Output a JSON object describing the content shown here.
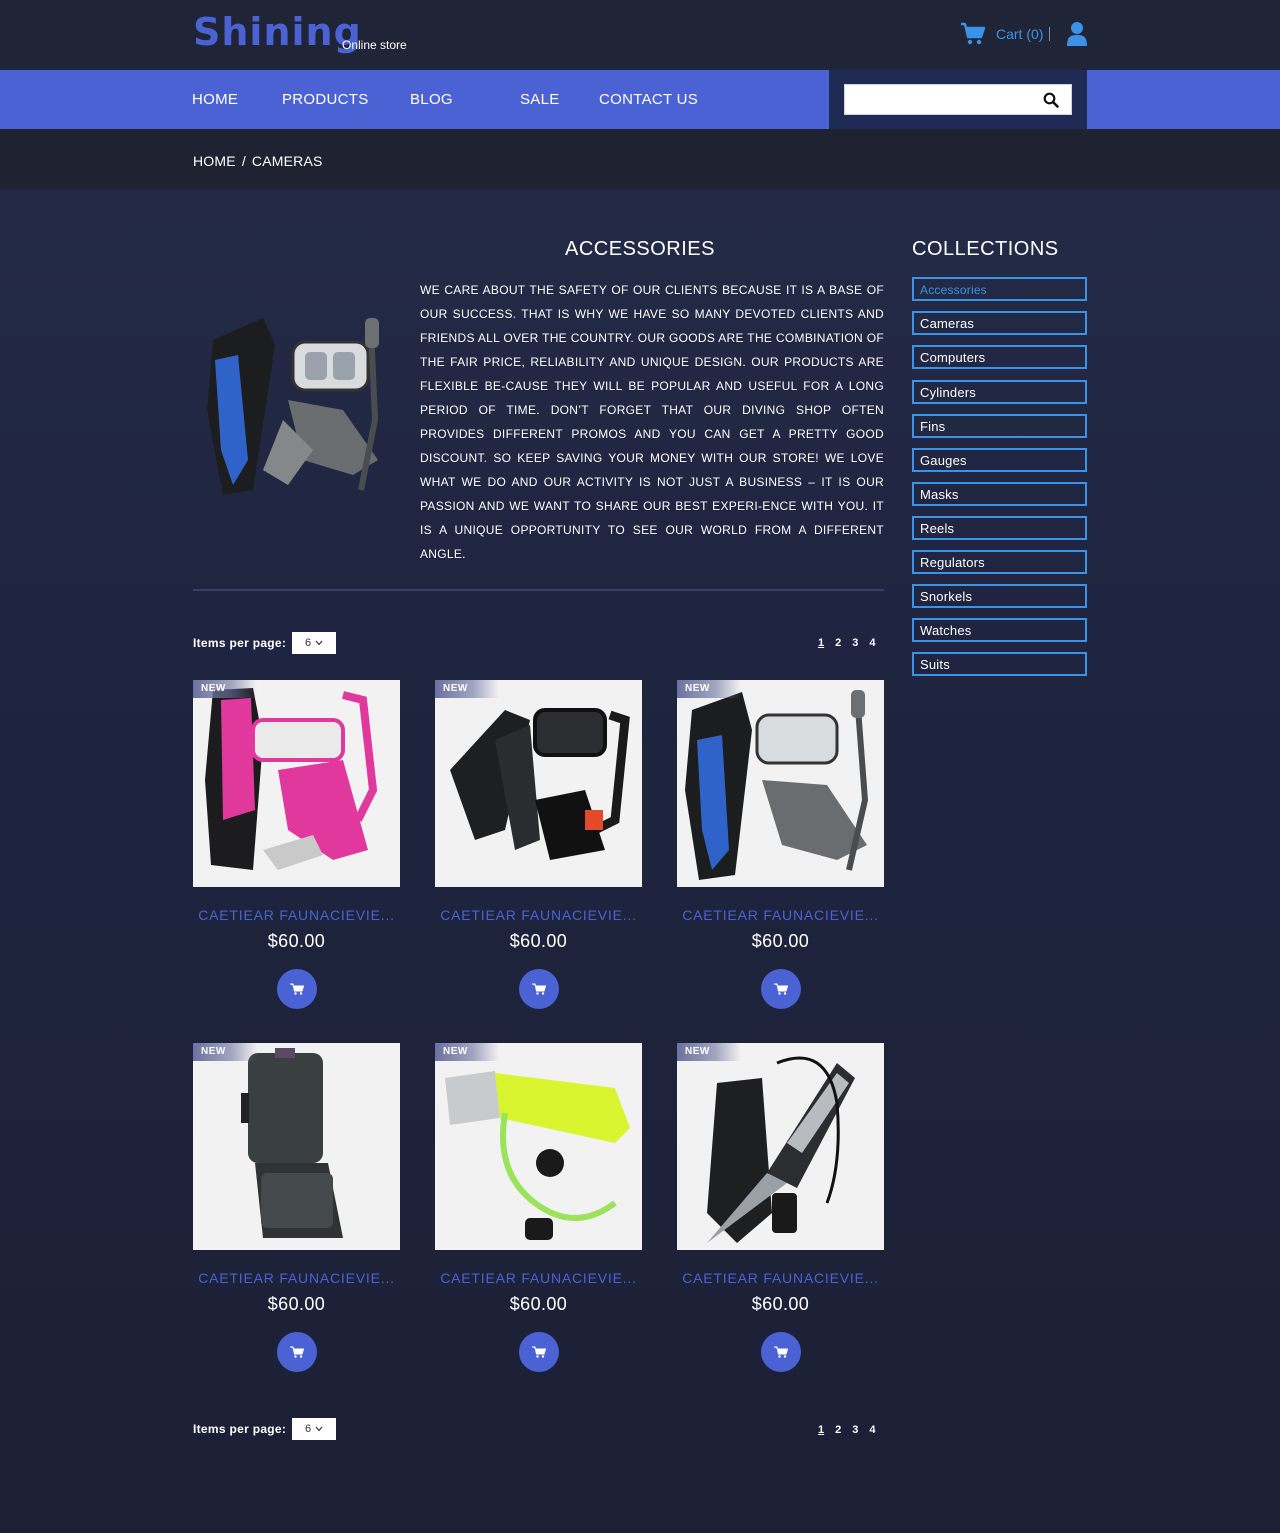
{
  "header": {
    "logo": "Shining",
    "tagline": "Online store",
    "cart_label": "Cart (0)"
  },
  "nav": {
    "items": [
      "HOME",
      "PRODUCTS",
      "BLOG",
      "SALE",
      "CONTACT US"
    ],
    "search_placeholder": ""
  },
  "breadcrumb": {
    "home": "HOME",
    "separator": "/",
    "current": "CAMERAS"
  },
  "category": {
    "title": "ACCESSORIES",
    "description": "We care about the safety of our clients because it is a base of our success. That is why we have so many devoted clients and friends all over the country. Our goods are the combination of the fair price, reliability and unique design. Our products are flexible be-cause they will be popular and useful for a long period of time. Don’t forget that our diving shop often provides different promos and you can get a pretty good discount. So keep saving your money with our store! We love what we do and our activity is not just a business – it is our passion and we want to share our best experi-ence with you. It is a unique opportunity to see our world from a different angle."
  },
  "listing": {
    "items_per_page_label": "Items per page:",
    "items_per_page_value": "6",
    "pages": [
      "1",
      "2",
      "3",
      "4"
    ],
    "current_page": "1"
  },
  "products": [
    {
      "badge": "NEW",
      "name": "CAETIEAR FAUNACIEVIE...",
      "price": "$60.00",
      "image": "pink-snorkel-set"
    },
    {
      "badge": "NEW",
      "name": "CAETIEAR FAUNACIEVIE...",
      "price": "$60.00",
      "image": "black-fins-mask-set"
    },
    {
      "badge": "NEW",
      "name": "CAETIEAR FAUNACIEVIE...",
      "price": "$60.00",
      "image": "blue-snorkel-set"
    },
    {
      "badge": "NEW",
      "name": "CAETIEAR FAUNACIEVIE...",
      "price": "$60.00",
      "image": "dry-box"
    },
    {
      "badge": "NEW",
      "name": "CAETIEAR FAUNACIEVIE...",
      "price": "$60.00",
      "image": "dive-flashlight"
    },
    {
      "badge": "NEW",
      "name": "CAETIEAR FAUNACIEVIE...",
      "price": "$60.00",
      "image": "dive-knife"
    }
  ],
  "sidebar": {
    "title": "COLLECTIONS",
    "items": [
      "Accessories",
      "Cameras",
      "Computers",
      "Cylinders",
      "Fins",
      "Gauges",
      "Masks",
      "Reels",
      "Regulators",
      "Snorkels",
      "Watches",
      "Suits"
    ],
    "active": "Accessories"
  },
  "colors": {
    "accent": "#4b62d4",
    "link_blue": "#3a93e6",
    "header_bg": "#1f2436"
  }
}
